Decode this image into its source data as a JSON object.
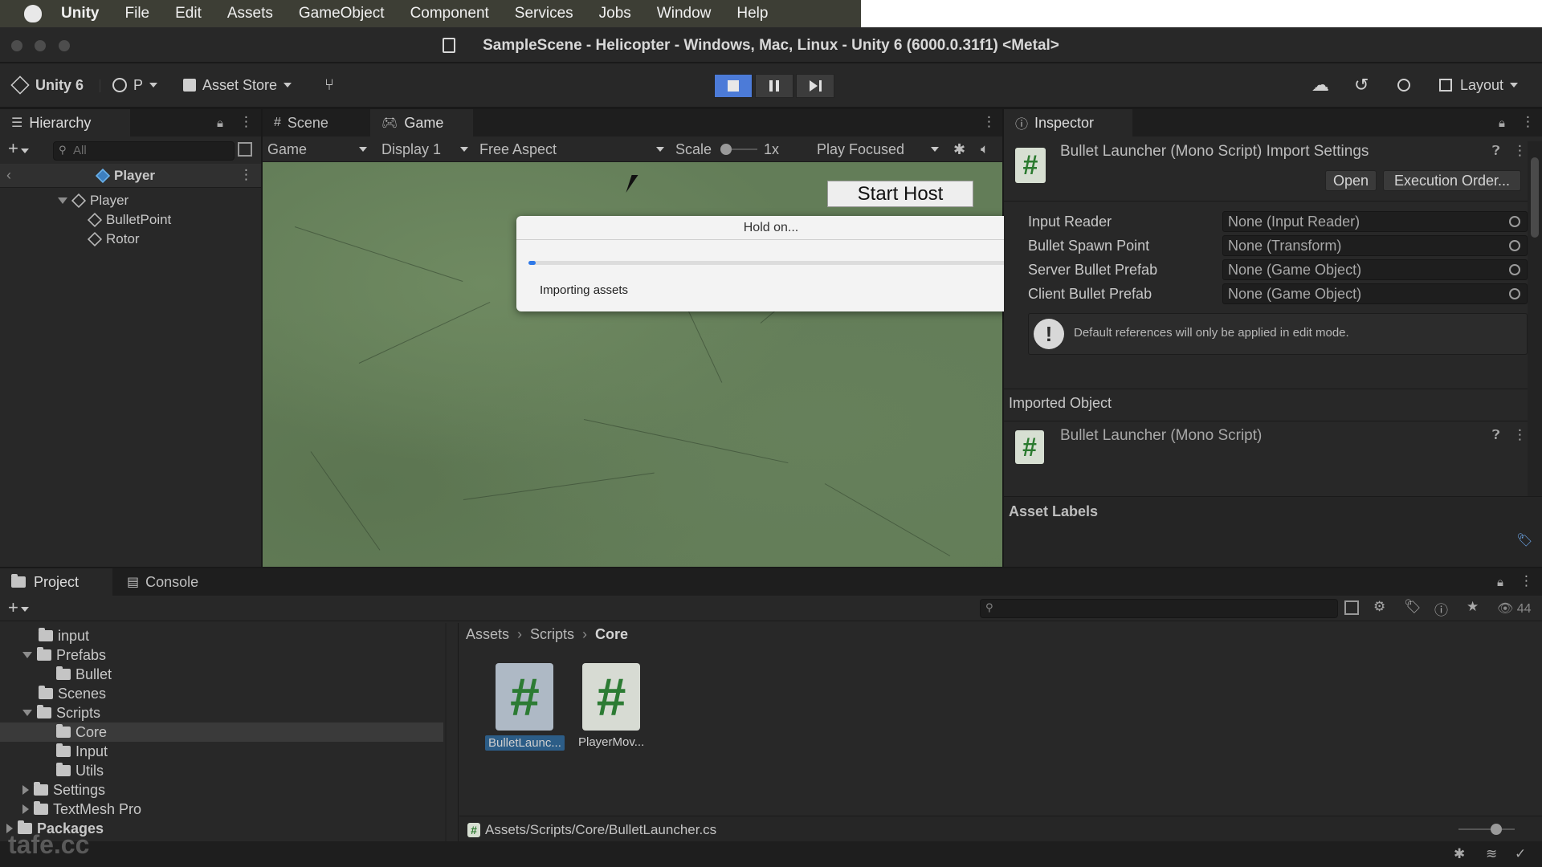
{
  "menubar": {
    "items": [
      "Unity",
      "File",
      "Edit",
      "Assets",
      "GameObject",
      "Component",
      "Services",
      "Jobs",
      "Window",
      "Help"
    ]
  },
  "window": {
    "title": "SampleScene - Helicopter - Windows, Mac, Linux - Unity 6 (6000.0.31f1) <Metal>"
  },
  "toolbar": {
    "unity_version_label": "Unity 6",
    "account_label": "P",
    "asset_store_label": "Asset Store",
    "layout_label": "Layout",
    "play_state": "playing"
  },
  "hierarchy": {
    "tab_label": "Hierarchy",
    "search_placeholder": "All",
    "prefab_header": "Player",
    "items": [
      {
        "label": "Player",
        "depth": 0
      },
      {
        "label": "BulletPoint",
        "depth": 1
      },
      {
        "label": "Rotor",
        "depth": 1
      }
    ]
  },
  "scene_tabs": {
    "scene_label": "Scene",
    "game_label": "Game"
  },
  "game_toolbar": {
    "view_mode": "Game",
    "display": "Display 1",
    "aspect": "Free Aspect",
    "scale_label": "Scale",
    "scale_value": "1x",
    "play_mode": "Play Focused"
  },
  "game_view": {
    "start_host_label": "Start Host"
  },
  "dialog": {
    "title": "Hold on...",
    "message": "Importing assets",
    "progress": 0.01
  },
  "inspector": {
    "tab_label": "Inspector",
    "header_title": "Bullet Launcher (Mono Script) Import Settings",
    "open_label": "Open",
    "execution_order_label": "Execution Order...",
    "fields": [
      {
        "label": "Input Reader",
        "value": "None (Input Reader)"
      },
      {
        "label": "Bullet Spawn Point",
        "value": "None (Transform)"
      },
      {
        "label": "Server Bullet Prefab",
        "value": "None (Game Object)"
      },
      {
        "label": "Client Bullet Prefab",
        "value": "None (Game Object)"
      }
    ],
    "info_message": "Default references will only be applied in edit mode.",
    "imported_object_header": "Imported Object",
    "imported_object_title": "Bullet Launcher (Mono Script)",
    "asset_labels_header": "Asset Labels"
  },
  "project": {
    "project_tab_label": "Project",
    "console_tab_label": "Console",
    "tree": [
      {
        "label": "input",
        "depth": 1,
        "arrow": "none"
      },
      {
        "label": "Prefabs",
        "depth": 1,
        "arrow": "down"
      },
      {
        "label": "Bullet",
        "depth": 2,
        "arrow": "none"
      },
      {
        "label": "Scenes",
        "depth": 1,
        "arrow": "none"
      },
      {
        "label": "Scripts",
        "depth": 1,
        "arrow": "down"
      },
      {
        "label": "Core",
        "depth": 2,
        "arrow": "none",
        "selected": true
      },
      {
        "label": "Input",
        "depth": 2,
        "arrow": "none"
      },
      {
        "label": "Utils",
        "depth": 2,
        "arrow": "none"
      },
      {
        "label": "Settings",
        "depth": 1,
        "arrow": "right"
      },
      {
        "label": "TextMesh Pro",
        "depth": 1,
        "arrow": "right"
      },
      {
        "label": "Packages",
        "depth": 0,
        "arrow": "right"
      }
    ],
    "breadcrumb": [
      "Assets",
      "Scripts",
      "Core"
    ],
    "assets": [
      {
        "label": "BulletLaunc...",
        "selected": true
      },
      {
        "label": "PlayerMov...",
        "selected": false
      }
    ],
    "selected_path": "Assets/Scripts/Core/BulletLauncher.cs",
    "hidden_count": "44"
  },
  "watermark": "tafe.cc",
  "colors": {
    "accent": "#4c7bd8",
    "game_bg": "#637d58",
    "script_icon_green": "#2c7b33"
  }
}
